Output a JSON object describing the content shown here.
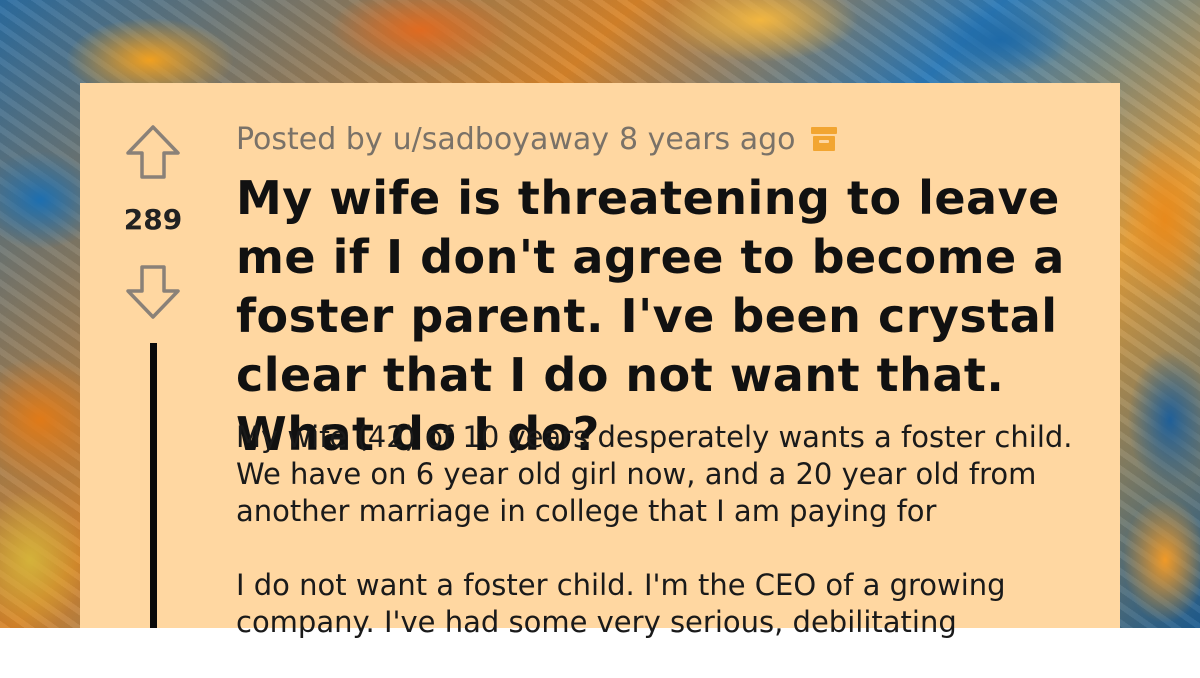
{
  "post": {
    "score": "289",
    "author_prefix": "Posted by",
    "author": "u/sadboyaway",
    "time": "8 years ago",
    "archived_icon": "archive-icon",
    "title": "My wife is threatening to leave me if I don't agree to become a foster parent. I've been crystal clear that I do not want that. What do I do?",
    "body": [
      "My wife (42) of 10 years desperately wants a foster child. We have on 6 year old girl now, and a 20 year old from another marriage in college that I am paying for",
      "I do not want a foster child. I'm the CEO of a growing company. I've had some very serious, debilitating"
    ]
  },
  "icons": {
    "upvote": "upvote-arrow-icon",
    "downvote": "downvote-arrow-icon"
  },
  "colors": {
    "card_background": "#ffd7a1",
    "archive_icon": "#f2a531",
    "meta_text": "#7a7268"
  }
}
